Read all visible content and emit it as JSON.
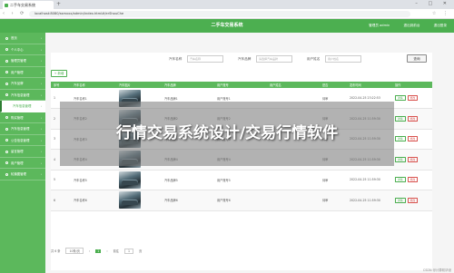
{
  "browser": {
    "tab_title": "二手车交易系统",
    "url": "localhost:8080/ssmxxx/admin/index.html#/erShouChe",
    "window_controls": "– □ ✕",
    "nav_buttons": "‹ › ⟳"
  },
  "app": {
    "title": "二手车交易系统",
    "user_label": "管理员 admin",
    "nav_links": [
      "退出到前台",
      "退出登录"
    ]
  },
  "sidebar": {
    "items": [
      {
        "label": "首页",
        "type": "top"
      },
      {
        "label": "个人中心",
        "type": "top"
      },
      {
        "label": "管理员管理",
        "type": "top"
      },
      {
        "label": "用户管理",
        "type": "top"
      },
      {
        "label": "汽车品牌",
        "type": "top"
      },
      {
        "label": "汽车信息管理",
        "type": "top"
      },
      {
        "label": "汽车信息管理",
        "type": "active"
      },
      {
        "label": "购买管理",
        "type": "top"
      },
      {
        "label": "汽车信息管理",
        "type": "top"
      },
      {
        "label": "公告信息管理",
        "type": "top"
      },
      {
        "label": "留言管理",
        "type": "top"
      },
      {
        "label": "用户管理",
        "type": "top"
      },
      {
        "label": "轮播图管理",
        "type": "top"
      }
    ]
  },
  "search": {
    "fields": [
      {
        "label": "汽车名称",
        "placeholder": "汽车名称"
      },
      {
        "label": "汽车品牌",
        "placeholder": "请选择汽车品牌"
      },
      {
        "label": "用户姓名",
        "placeholder": "用户姓名"
      }
    ],
    "button": "查询"
  },
  "add_button": "+ 新增",
  "table": {
    "headers": [
      "序号",
      "汽车名称",
      "汽车图片",
      "汽车品牌",
      "用户账号",
      "用户姓名",
      "是否",
      "发布时间",
      "操作"
    ],
    "rows": [
      {
        "no": "1",
        "name": "汽车名称1",
        "brand": "汽车品牌1",
        "account": "用户账号1",
        "user": "",
        "flag": "待审",
        "time": "2022-04-25 23:22:53"
      },
      {
        "no": "2",
        "name": "汽车名称2",
        "brand": "汽车品牌2",
        "account": "用户账号2",
        "user": "",
        "flag": "待审",
        "time": "2022-04-25 11:59:30"
      },
      {
        "no": "3",
        "name": "汽车名称3",
        "brand": "汽车品牌3",
        "account": "用户账号3",
        "user": "",
        "flag": "待审",
        "time": "2022-04-25 11:59:30"
      },
      {
        "no": "4",
        "name": "汽车名称4",
        "brand": "汽车品牌4",
        "account": "用户账号4",
        "user": "",
        "flag": "待审",
        "time": "2022-04-25 11:59:30"
      },
      {
        "no": "5",
        "name": "汽车名称5",
        "brand": "汽车品牌5",
        "account": "用户账号5",
        "user": "",
        "flag": "待审",
        "time": "2022-04-25 11:59:30"
      },
      {
        "no": "6",
        "name": "汽车名称6",
        "brand": "汽车品牌6",
        "account": "用户账号6",
        "user": "",
        "flag": "待审",
        "time": "2022-04-25 11:59:30"
      }
    ],
    "actions": [
      "详情",
      "修改"
    ]
  },
  "pager": {
    "total": "共 6 条",
    "page_size": "10条/页",
    "prev": "‹",
    "current": "1",
    "next": "›",
    "goto_label": "前往",
    "goto_value": "1",
    "goto_suffix": "页"
  },
  "overlay_title": "行情交易系统设计/交易行情软件",
  "watermark": "CSDN @计算机毕设"
}
